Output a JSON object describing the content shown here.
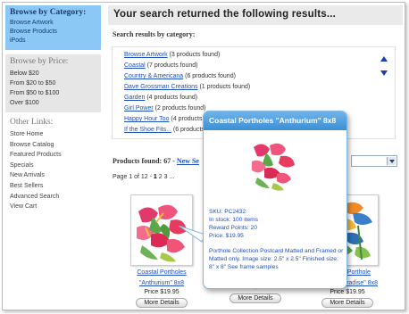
{
  "sidebar": {
    "category": {
      "title": "Browse by Category:",
      "items": [
        "Browse Artwork",
        "Browse Products",
        "iPods"
      ]
    },
    "price": {
      "title": "Browse by Price:",
      "items": [
        "Below $20",
        "From $20 to $50",
        "From $50 to $100",
        "Over $100"
      ]
    },
    "links": {
      "title": "Other Links:",
      "items": [
        "Store Home",
        "Browse Catalog",
        "Featured Products",
        "Specials",
        "New Arrivals",
        "Best Sellers",
        "Advanced Search",
        "View Cart"
      ]
    }
  },
  "main": {
    "title": "Your search returned the following results...",
    "subheading": "Search results by category:",
    "categories": [
      {
        "name": "Browse Artwork",
        "count": "(3 products found)"
      },
      {
        "name": "Coastal",
        "count": "(7 products found)"
      },
      {
        "name": "Country & Americana",
        "count": "(6 products found)"
      },
      {
        "name": "Dave Grossman Creations",
        "count": "(1 products found)"
      },
      {
        "name": "Garden",
        "count": "(4 products found)"
      },
      {
        "name": "Girl Power",
        "count": "(2 products found)"
      },
      {
        "name": "Happy Hour Too",
        "count": "(4 products found)"
      },
      {
        "name": "If the Shoe Fits...",
        "count": "(6 products found)"
      }
    ],
    "found_label": "Products found: 67 - ",
    "new_search": "New Se",
    "page_label": "Page 1 of 12 - ",
    "pages": [
      "1",
      "2",
      "3"
    ],
    "page_more": "...",
    "products": [
      {
        "name_line1": "Coastal Portholes",
        "name_line2": "\"Anthurium\" 8x8",
        "price": "Price $19.95",
        "button": "More Details"
      },
      {
        "name_line1": "",
        "name_line2": "",
        "price": "Price $19.95",
        "button": "More Details"
      },
      {
        "name_line1": "Coastal Porthole",
        "name_line2": "\"Bird of Paradise\" 8x8",
        "price": "Price $19.95",
        "button": "More Details"
      }
    ]
  },
  "popup": {
    "title": "Coastal Portholes \"Anthurium\" 8x8",
    "sku": "SKU: PC2432",
    "stock": "In stock: 100 items",
    "reward": "Reward Points: 20",
    "price": "Price: $19.95",
    "description": "Porthole Collection Postcard Matted and Framed or Matted only. Image size: 2.5\" x 2.5\" Finished size: 8\" x 8\" See frame samples"
  },
  "colors": {
    "accent_blue": "#8cc8f5",
    "link": "#1f4fbf",
    "popup_header": "#3b8fd4"
  }
}
